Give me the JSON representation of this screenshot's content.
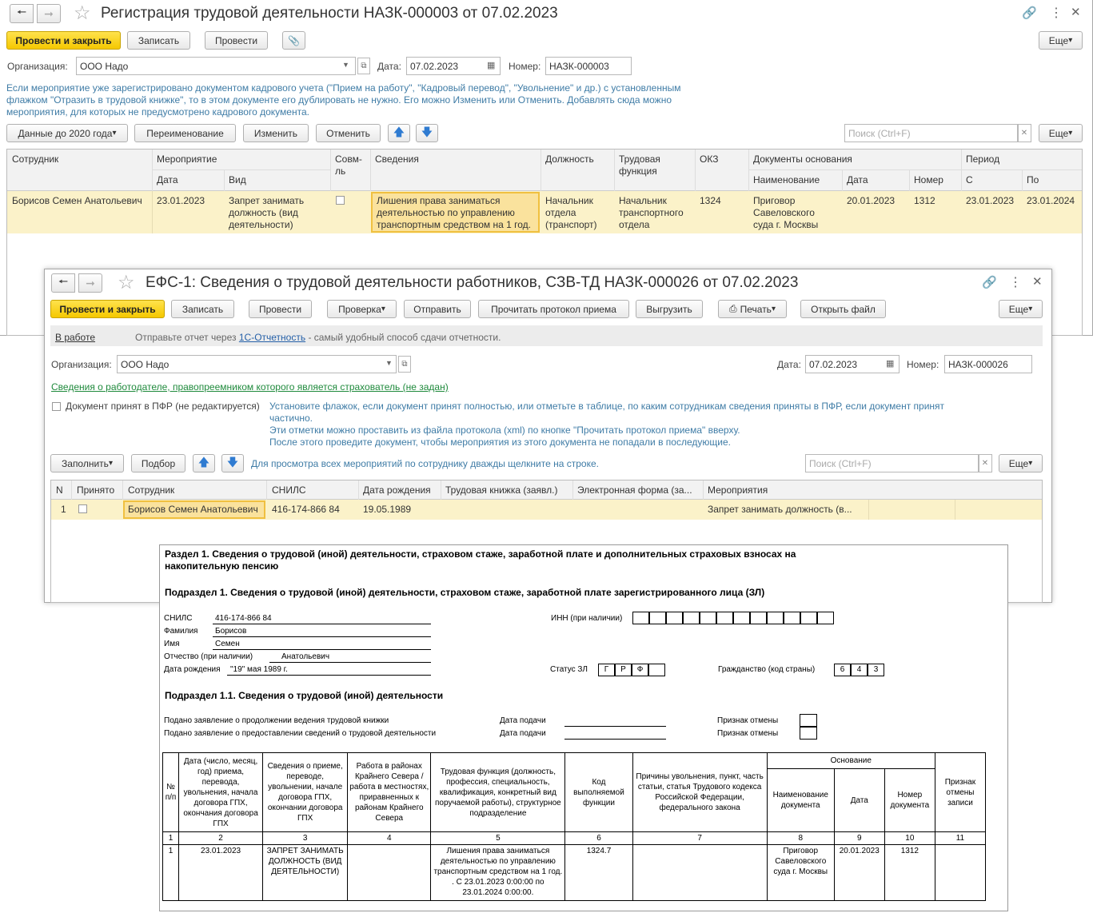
{
  "win1": {
    "title": "Регистрация трудовой деятельности НАЗК-000003 от 07.02.2023",
    "buttons": {
      "post_close": "Провести и закрыть",
      "save": "Записать",
      "post": "Провести",
      "more": "Еще"
    },
    "org_label": "Организация:",
    "org_value": "ООО Надо",
    "date_label": "Дата:",
    "date_value": "07.02.2023",
    "num_label": "Номер:",
    "num_value": "НАЗК-000003",
    "note": "Если мероприятие уже зарегистрировано документом кадрового учета (\"Прием на работу\", \"Кадровый перевод\", \"Увольнение\" и др.) с установленным флажком \"Отразить в трудовой книжке\", то в этом документе его дублировать не нужно. Его можно Изменить или Отменить. Добавлять сюда можно мероприятия, для которых не предусмотрено кадрового документа.",
    "tb": {
      "data2020": "Данные до 2020 года",
      "rename": "Переименование",
      "change": "Изменить",
      "cancel": "Отменить",
      "search_placeholder": "Поиск (Ctrl+F)",
      "more": "Еще"
    },
    "cols": {
      "employee": "Сотрудник",
      "event": "Мероприятие",
      "date": "Дата",
      "kind": "Вид",
      "sovm": "Совм-ль",
      "info": "Сведения",
      "position": "Должность",
      "func": "Трудовая функция",
      "okz": "ОКЗ",
      "docs": "Документы основания",
      "doc_name": "Наименование",
      "doc_date": "Дата",
      "doc_num": "Номер",
      "period": "Период",
      "from": "С",
      "to": "По"
    },
    "row": {
      "employee": "Борисов Семен Анатольевич",
      "date": "23.01.2023",
      "kind": "Запрет занимать должность (вид деятельности)",
      "info": "Лишения права заниматься деятельностью по управлению транспортным средством на 1 год.",
      "position": "Начальник отдела (транспорт)",
      "func": "Начальник транспортного отдела",
      "okz": "1324",
      "doc_name": "Приговор Савеловского суда г. Москвы",
      "doc_date": "20.01.2023",
      "doc_num": "1312",
      "from": "23.01.2023",
      "to": "23.01.2024"
    }
  },
  "win2": {
    "title": "ЕФС-1: Сведения о трудовой деятельности работников, СЗВ-ТД НАЗК-000026 от 07.02.2023",
    "buttons": {
      "post_close": "Провести и закрыть",
      "save": "Записать",
      "post": "Провести",
      "check": "Проверка",
      "send": "Отправить",
      "read_protocol": "Прочитать протокол приема",
      "upload": "Выгрузить",
      "print": "Печать",
      "open_file": "Открыть файл",
      "more": "Еще"
    },
    "status": "В работе",
    "send_text1": "Отправьте отчет через",
    "send_link": "1С-Отчетность",
    "send_text2": "- самый удобный способ сдачи отчетности.",
    "org_label": "Организация:",
    "org_value": "ООО Надо",
    "date_label": "Дата:",
    "date_value": "07.02.2023",
    "num_label": "Номер:",
    "num_value": "НАЗК-000026",
    "successor_link": "Сведения о работодателе, правопреемником которого является страхователь (не задан)",
    "accepted_label": "Документ принят в ПФР (не редактируется)",
    "note1": "Установите флажок, если документ принят полностью, или отметьте в таблице, по каким сотрудникам сведения приняты в ПФР, если документ принят частично.",
    "note2": "Эти отметки можно проставить из файла протокола (xml) по кнопке \"Прочитать протокол приема\" вверху.",
    "note3": "После этого проведите документ, чтобы мероприятия из этого документа не попадали в последующие.",
    "tb": {
      "fill": "Заполнить",
      "select": "Подбор",
      "hint": "Для просмотра всех мероприятий по сотруднику дважды щелкните на строке.",
      "search_placeholder": "Поиск (Ctrl+F)",
      "more": "Еще"
    },
    "cols": {
      "n": "N",
      "accepted": "Принято",
      "employee": "Сотрудник",
      "snils": "СНИЛС",
      "birth": "Дата рождения",
      "book": "Трудовая книжка (заявл.)",
      "eform": "Электронная форма (за...",
      "events": "Мероприятия"
    },
    "row": {
      "n": "1",
      "employee": "Борисов Семен Анатольевич",
      "snils": "416-174-866 84",
      "birth": "19.05.1989",
      "events": "Запрет занимать должность (в..."
    }
  },
  "form": {
    "section1": "Раздел 1. Сведения о трудовой (иной) деятельности, страховом стаже, заработной плате и дополнительных страховых взносах на накопительную пенсию",
    "subsection1": "Подраздел 1. Сведения о трудовой (иной) деятельности, страховом стаже, заработной плате зарегистрированного лица (ЗЛ)",
    "snils_label": "СНИЛС",
    "snils": "416-174-866 84",
    "surname_label": "Фамилия",
    "surname": "Борисов",
    "name_label": "Имя",
    "name": "Семен",
    "patronymic_label": "Отчество (при наличии)",
    "patronymic": "Анатольевич",
    "birth_label": "Дата рождения",
    "birth": "\"19\" мая 1989 г.",
    "inn_label": "ИНН (при наличии)",
    "status_label": "Статус ЗЛ",
    "status_boxes": [
      "Г",
      "Р",
      "Ф",
      ""
    ],
    "citizenship_label": "Гражданство (код страны)",
    "citizenship_boxes": [
      "6",
      "4",
      "3"
    ],
    "subsection11": "Подраздел 1.1. Сведения о трудовой (иной) деятельности",
    "app1": "Подано заявление о продолжении ведения трудовой книжки",
    "app2": "Подано заявление о предоставлении сведений о трудовой деятельности",
    "date_submit": "Дата подачи",
    "cancel_sign": "Признак отмены",
    "th": {
      "n": "№ п/п",
      "date": "Дата (число, месяц, год) приема, перевода, увольнения, начала договора ГПХ, окончания договора ГПХ",
      "info": "Сведения о приеме, переводе, увольнении, начале договора ГПХ, окончании договора ГПХ",
      "north": "Работа в районах Крайнего Севера / работа в местностях, приравненных к районам Крайнего Севера",
      "func": "Трудовая функция (должность, профессия, специальность, квалификация, конкретный вид поручаемой работы), структурное подразделение",
      "code": "Код выполняемой функции",
      "reason": "Причины увольнения, пункт, часть статьи, статья Трудового кодекса Российской Федерации, федерального закона",
      "basis": "Основание",
      "doc_name": "Наименование документа",
      "doc_date": "Дата",
      "doc_num": "Номер документа",
      "cancel": "Признак отмены записи"
    },
    "nums": [
      "1",
      "2",
      "3",
      "4",
      "5",
      "6",
      "7",
      "8",
      "9",
      "10",
      "11"
    ],
    "row": {
      "n": "1",
      "date": "23.01.2023",
      "info": "ЗАПРЕТ ЗАНИМАТЬ ДОЛЖНОСТЬ (ВИД ДЕЯТЕЛЬНОСТИ)",
      "north": "",
      "func": "Лишения права заниматься деятельностью по управлению транспортным средством на 1 год. . С 23.01.2023 0:00:00 по 23.01.2024 0:00:00.",
      "code": "1324.7",
      "reason": "",
      "doc_name": "Приговор Савеловского суда г. Москвы",
      "doc_date": "20.01.2023",
      "doc_num": "1312",
      "cancel": ""
    }
  }
}
